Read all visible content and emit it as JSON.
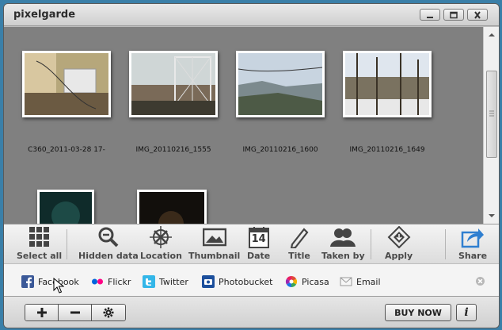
{
  "app": {
    "title": "pixelgarde"
  },
  "gallery": {
    "photos": [
      {
        "name": "C360_2011-03-28 17-",
        "colors": [
          "#b6a77b",
          "#d8c7a0",
          "#6b5a42"
        ]
      },
      {
        "name": "IMG_20110216_1555",
        "colors": [
          "#cfd6d6",
          "#7a6a58",
          "#3d3a30"
        ]
      },
      {
        "name": "IMG_20110216_1600",
        "colors": [
          "#c8d4e0",
          "#7c8a8e",
          "#4d5a46"
        ]
      },
      {
        "name": "IMG_20110216_1649",
        "colors": [
          "#dfe6ee",
          "#7a7260",
          "#e8e8e8"
        ]
      },
      {
        "name": "",
        "colors": [
          "#0f2b2a",
          "#1d4a46",
          "#0a1414"
        ]
      },
      {
        "name": "",
        "colors": [
          "#120f0c",
          "#3a2a1a",
          "#070605"
        ]
      }
    ]
  },
  "toolbar": {
    "select_all": "Select all",
    "hidden_data": "Hidden data",
    "location": "Location",
    "thumbnail": "Thumbnail",
    "date": "Date",
    "date_icon_day": "14",
    "title": "Title",
    "taken_by": "Taken by",
    "apply": "Apply",
    "share": "Share"
  },
  "sharebar": {
    "facebook": "Facebook",
    "flickr": "Flickr",
    "twitter": "Twitter",
    "photobucket": "Photobucket",
    "picasa": "Picasa",
    "email": "Email"
  },
  "bottombar": {
    "buy_now": "BUY NOW",
    "info": "i"
  },
  "colors": {
    "gallery_bg": "#808080",
    "accent_blue": "#2f7fd0"
  }
}
